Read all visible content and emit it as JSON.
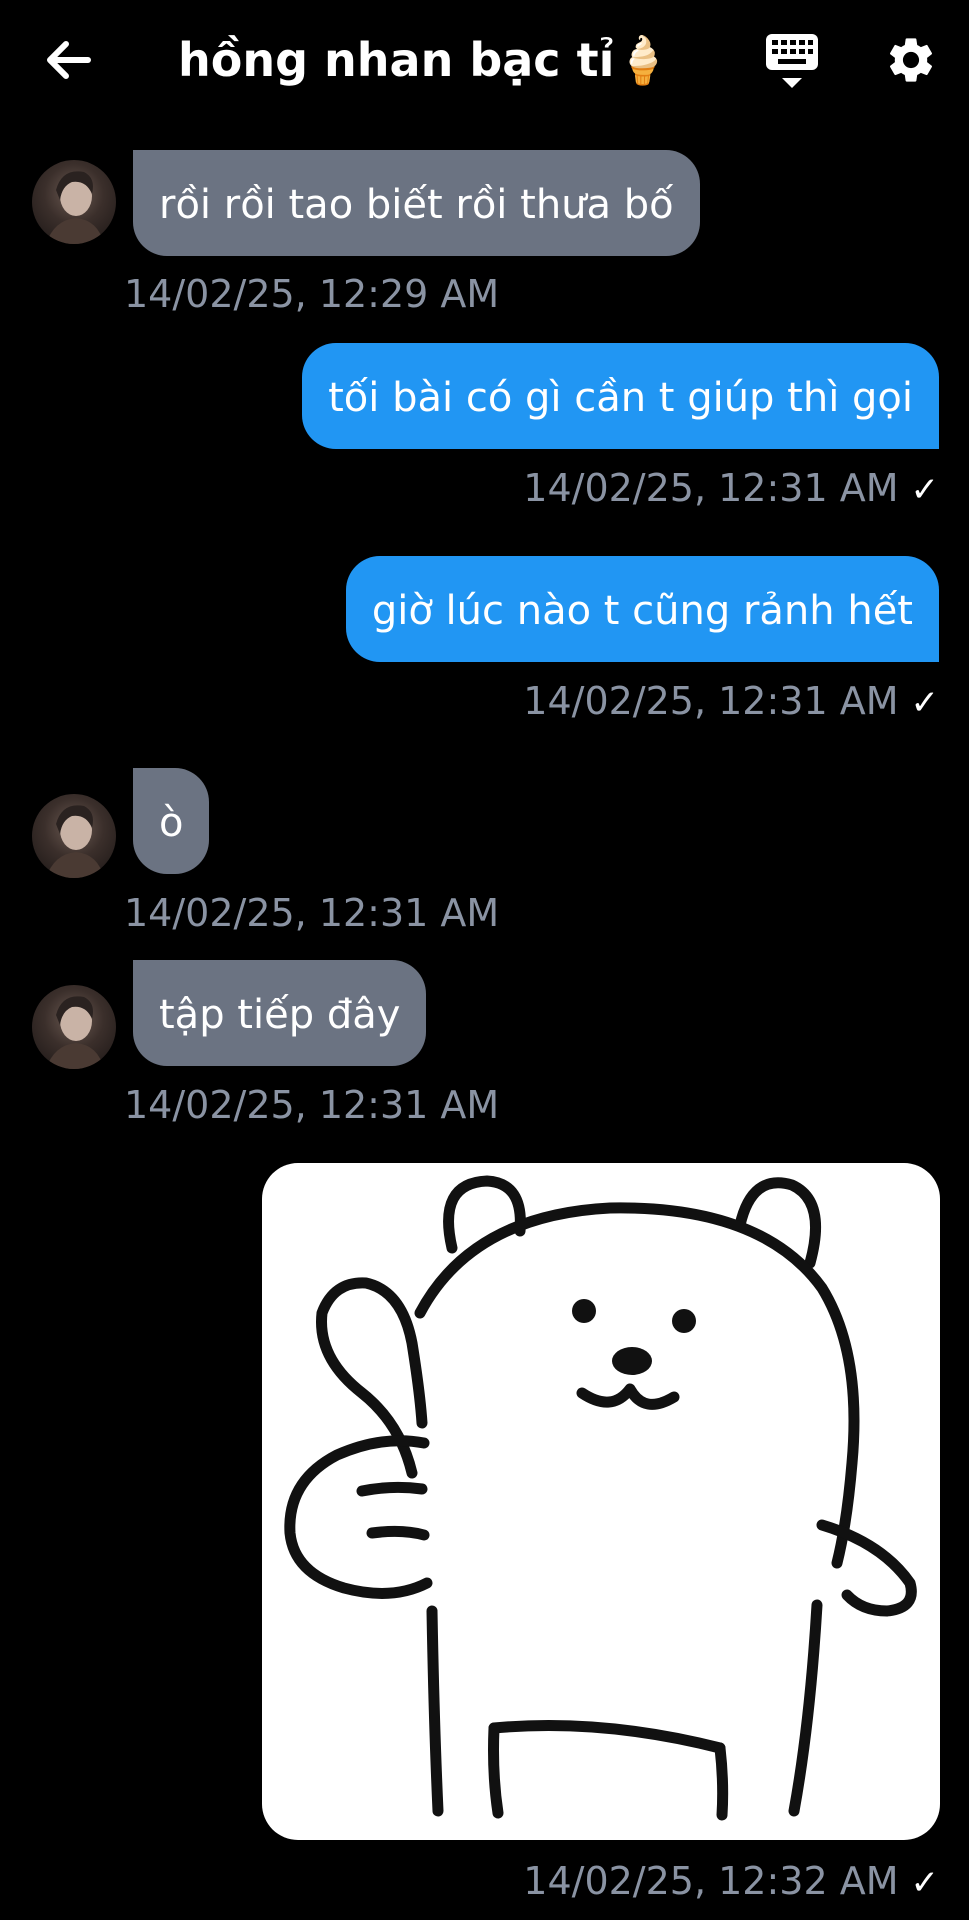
{
  "header": {
    "title": "hồng nhan bạc tỉ🍦",
    "back_icon": "back-arrow-icon",
    "keyboard_icon": "keyboard-icon",
    "settings_icon": "gear-icon"
  },
  "messages": [
    {
      "direction": "incoming",
      "text": "rồi rồi tao biết rồi thưa bố",
      "time": "14/02/25, 12:29 AM"
    },
    {
      "direction": "outgoing",
      "text": "tối bài có gì cần t giúp thì gọi",
      "time": "14/02/25, 12:31 AM",
      "status": "✓"
    },
    {
      "direction": "outgoing",
      "text": "giờ lúc nào t cũng rảnh hết",
      "time": "14/02/25, 12:31 AM",
      "status": "✓"
    },
    {
      "direction": "incoming",
      "text": "ò",
      "time": "14/02/25, 12:31 AM"
    },
    {
      "direction": "incoming",
      "text": "tập tiếp đây",
      "time": "14/02/25, 12:31 AM"
    },
    {
      "direction": "outgoing",
      "type": "sticker",
      "sticker": "thumbs-up-bear",
      "time": "14/02/25, 12:32 AM",
      "status": "✓"
    }
  ],
  "colors": {
    "background": "#000000",
    "incoming_bubble": "#6b7382",
    "outgoing_bubble": "#2196f3",
    "timestamp": "#8a93a3"
  }
}
